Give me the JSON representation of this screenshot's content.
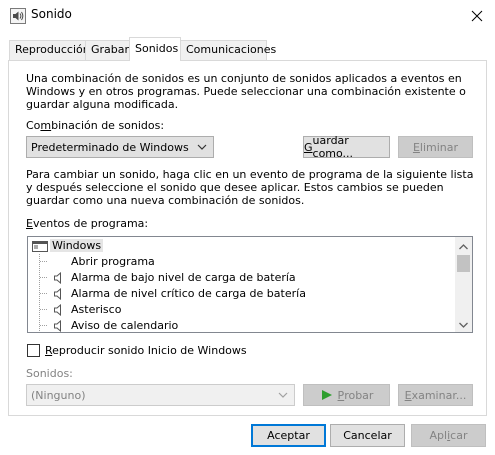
{
  "window": {
    "title": "Sonido"
  },
  "tabs": [
    {
      "label": "Reproducción",
      "active": false
    },
    {
      "label": "Grabar",
      "active": false
    },
    {
      "label": "Sonidos",
      "active": true
    },
    {
      "label": "Comunicaciones",
      "active": false
    }
  ],
  "intro_text": [
    "Una combinación de sonidos es un conjunto de sonidos aplicados a eventos en",
    "Windows y en otros programas. Puede seleccionar una combinación existente o",
    "guardar alguna modificada."
  ],
  "scheme": {
    "label_pre": "Co",
    "label_key": "m",
    "label_post": "binación de sonidos:",
    "selected": "Predeterminado de Windows",
    "save_pre": "",
    "save_key": "G",
    "save_post": "uardar como...",
    "delete_pre": "",
    "delete_key": "E",
    "delete_post": "liminar"
  },
  "change_text": [
    "Para cambiar un sonido, haga clic en un evento de programa de la siguiente lista",
    "y después seleccione el sonido que desee aplicar. Estos cambios se pueden",
    "guardar como una nueva combinación de sonidos."
  ],
  "events": {
    "label_pre": "",
    "label_key": "E",
    "label_post": "ventos de programa:",
    "items": [
      {
        "label": "Windows",
        "kind": "group",
        "selected": true
      },
      {
        "label": "Abrir programa",
        "kind": "event",
        "has_sound": false
      },
      {
        "label": "Alarma de bajo nivel de carga de batería",
        "kind": "event",
        "has_sound": true
      },
      {
        "label": "Alarma de nivel crítico de carga de batería",
        "kind": "event",
        "has_sound": true
      },
      {
        "label": "Asterisco",
        "kind": "event",
        "has_sound": true
      },
      {
        "label": "Aviso de calendario",
        "kind": "event",
        "has_sound": true
      }
    ]
  },
  "startup_checkbox": {
    "key": "R",
    "post": "eproducir sonido Inicio de Windows",
    "checked": false
  },
  "sounds": {
    "label": "Sonidos:",
    "selected": "(Ninguno)",
    "test_key": "P",
    "test_post": "robar",
    "browse_pre": "",
    "browse_key": "E",
    "browse_post": "xaminar..."
  },
  "footer": {
    "ok": "Aceptar",
    "cancel": "Cancelar",
    "apply_pre": "Apl",
    "apply_key": "i",
    "apply_post": "car"
  },
  "colors": {
    "accent": "#0078d7",
    "disabled_text": "#838383",
    "play_icon": "#2e9e2e"
  }
}
